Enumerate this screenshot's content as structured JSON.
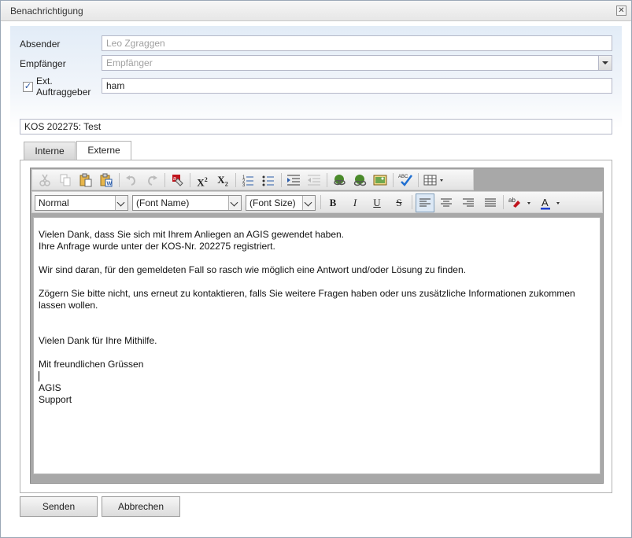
{
  "window": {
    "title": "Benachrichtigung"
  },
  "form": {
    "absender": {
      "label": "Absender",
      "value": "Leo Zgraggen"
    },
    "empfaenger": {
      "label": "Empfänger",
      "placeholder": "Empfänger"
    },
    "ext_auftraggeber": {
      "label_line1": "Ext.",
      "label_line2": "Auftraggeber",
      "checked": true,
      "value": "ham"
    },
    "subject": {
      "value": "KOS 202275: Test"
    }
  },
  "tabs": [
    {
      "label": "Interne",
      "active": false
    },
    {
      "label": "Externe",
      "active": true
    }
  ],
  "toolbar": {
    "format_select": "Normal",
    "font_name_select": "(Font Name)",
    "font_size_select": "(Font Size)",
    "bold": "B",
    "italic": "I",
    "underline": "U",
    "strike": "S",
    "superscript": "X",
    "subscript": "X",
    "spellcheck": "ABC",
    "highlight": "ab",
    "font_color": "A"
  },
  "body": {
    "line1": "Vielen Dank, dass Sie sich mit Ihrem Anliegen an AGIS gewendet haben.",
    "line2": "Ihre Anfrage wurde unter der KOS-Nr. 202275 registriert.",
    "line3": "Wir sind daran, für den gemeldeten Fall so rasch wie möglich eine Antwort und/oder Lösung zu finden.",
    "line4": "Zögern Sie bitte nicht, uns erneut zu kontaktieren, falls Sie weitere Fragen haben oder uns zusätzliche Informationen zukommen",
    "line5": "lassen wollen.",
    "line6": "Vielen Dank für Ihre Mithilfe.",
    "line7": "Mit freundlichen Grüssen",
    "line8": "AGIS",
    "line9": "Support"
  },
  "buttons": {
    "send": "Senden",
    "cancel": "Abbrechen"
  },
  "colors": {
    "accent_check": "#1f4e9c",
    "font_color_underline": "#1c3fd1",
    "highlight_red": "#c0141c"
  }
}
